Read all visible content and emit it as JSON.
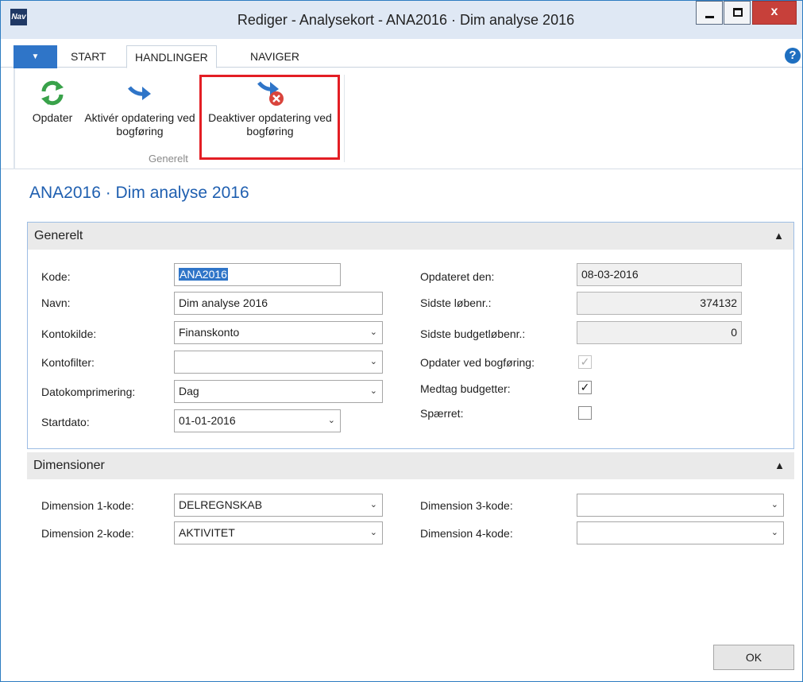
{
  "window": {
    "title": "Rediger - Analysekort - ANA2016 · Dim analyse 2016",
    "app_logo": "Nav",
    "minimize_icon": "minimize-icon",
    "maximize_icon": "maximize-icon",
    "close_label": "x"
  },
  "ribbon": {
    "tabs": [
      {
        "label": "START"
      },
      {
        "label": "HANDLINGER"
      },
      {
        "label": "NAVIGER"
      }
    ],
    "help_label": "?",
    "menu_icon": "dropdown-triangle-icon",
    "actions": [
      {
        "label": "Opdater",
        "icon": "refresh-icon"
      },
      {
        "label": "Aktivér opdatering ved bogføring",
        "icon": "arrow-right-icon"
      },
      {
        "label": "Deaktiver opdatering ved bogføring",
        "icon": "arrow-cancel-icon"
      }
    ],
    "group_label": "Generelt",
    "highlight_color": "#e31e24"
  },
  "page": {
    "title": "ANA2016 · Dim analyse 2016"
  },
  "general": {
    "header": "Generelt",
    "kode": {
      "label": "Kode:",
      "value": "ANA2016"
    },
    "navn": {
      "label": "Navn:",
      "value": "Dim analyse 2016"
    },
    "kontokilde": {
      "label": "Kontokilde:",
      "value": "Finanskonto"
    },
    "kontofilter": {
      "label": "Kontofilter:",
      "value": ""
    },
    "datokomprimering": {
      "label": "Datokomprimering:",
      "value": "Dag"
    },
    "startdato": {
      "label": "Startdato:",
      "value": "01-01-2016"
    },
    "opdateret_den": {
      "label": "Opdateret den:",
      "value": "08-03-2016"
    },
    "sidste_lobenr": {
      "label": "Sidste løbenr.:",
      "value": "374132"
    },
    "sidste_budget": {
      "label": "Sidste budgetløbenr.:",
      "value": "0"
    },
    "opdater_bogforing": {
      "label": "Opdater ved bogføring:",
      "checked": true,
      "mark": "✓"
    },
    "medtag_budgetter": {
      "label": "Medtag budgetter:",
      "checked": true,
      "mark": "✓"
    },
    "spaerret": {
      "label": "Spærret:",
      "checked": false,
      "mark": ""
    }
  },
  "dimensions": {
    "header": "Dimensioner",
    "dim1": {
      "label": "Dimension 1-kode:",
      "value": "DELREGNSKAB"
    },
    "dim2": {
      "label": "Dimension 2-kode:",
      "value": "AKTIVITET"
    },
    "dim3": {
      "label": "Dimension 3-kode:",
      "value": ""
    },
    "dim4": {
      "label": "Dimension 4-kode:",
      "value": ""
    }
  },
  "footer": {
    "ok_label": "OK"
  }
}
